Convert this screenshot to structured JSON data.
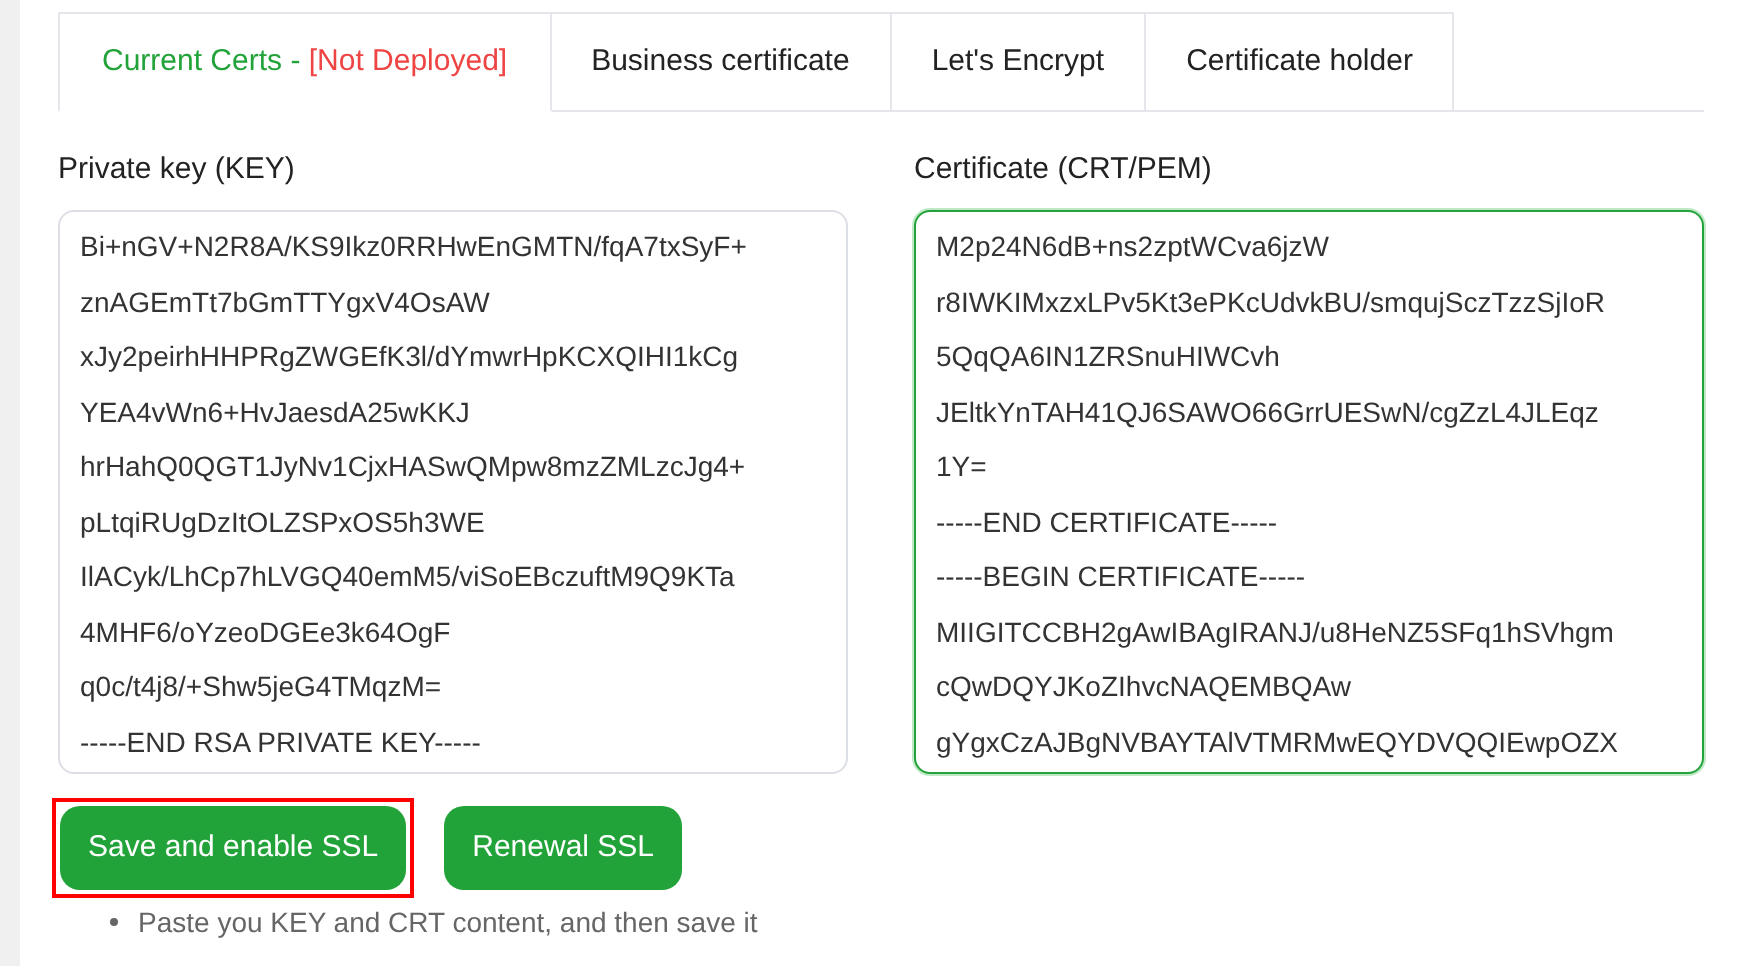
{
  "tabs": [
    {
      "label": "Current Certs -",
      "status": "[Not Deployed]",
      "selected": true
    },
    {
      "label": "Business certificate",
      "selected": false
    },
    {
      "label": "Let's Encrypt",
      "selected": false
    },
    {
      "label": "Certificate holder",
      "selected": false
    }
  ],
  "private_key": {
    "label": "Private key (KEY)",
    "focused": false,
    "lines": [
      "Bi+nGV+N2R8A/KS9Ikz0RRHwEnGMTN/fqA7txSyF+",
      "znAGEmTt7bGmTTYgxV4OsAW",
      "xJy2peirhHHPRgZWGEfK3l/dYmwrHpKCXQIHI1kCg",
      "YEA4vWn6+HvJaesdA25wKKJ",
      "hrHahQ0QGT1JyNv1CjxHASwQMpw8mzZMLzcJg4+",
      "pLtqiRUgDzItOLZSPxOS5h3WE",
      "IlACyk/LhCp7hLVGQ40emM5/viSoEBczuftM9Q9KTa",
      "4MHF6/oYzeoDGEe3k64OgF",
      "q0c/t4j8/+Shw5jeG4TMqzM=",
      "-----END RSA PRIVATE KEY-----"
    ]
  },
  "certificate": {
    "label": "Certificate (CRT/PEM)",
    "focused": true,
    "lines": [
      "M2p24N6dB+ns2zptWCva6jzW",
      "r8IWKIMxzxLPv5Kt3ePKcUdvkBU/smqujSczTzzSjIoR",
      "5QqQA6IN1ZRSnuHIWCvh",
      "JEltkYnTAH41QJ6SAWO66GrrUESwN/cgZzL4JLEqz",
      "1Y=",
      "-----END CERTIFICATE-----",
      "-----BEGIN CERTIFICATE-----",
      "MIIGITCCBH2gAwIBAgIRANJ/u8HeNZ5SFq1hSVhgm",
      "cQwDQYJKoZIhvcNAQEMBQAw",
      "gYgxCzAJBgNVBAYTAlVTMRMwEQYDVQQIEwpOZX"
    ]
  },
  "buttons": [
    {
      "label": "Save and enable SSL",
      "highlighted": true
    },
    {
      "label": "Renewal SSL",
      "highlighted": false
    }
  ],
  "notes": [
    "Paste you KEY and CRT content, and then save it"
  ]
}
